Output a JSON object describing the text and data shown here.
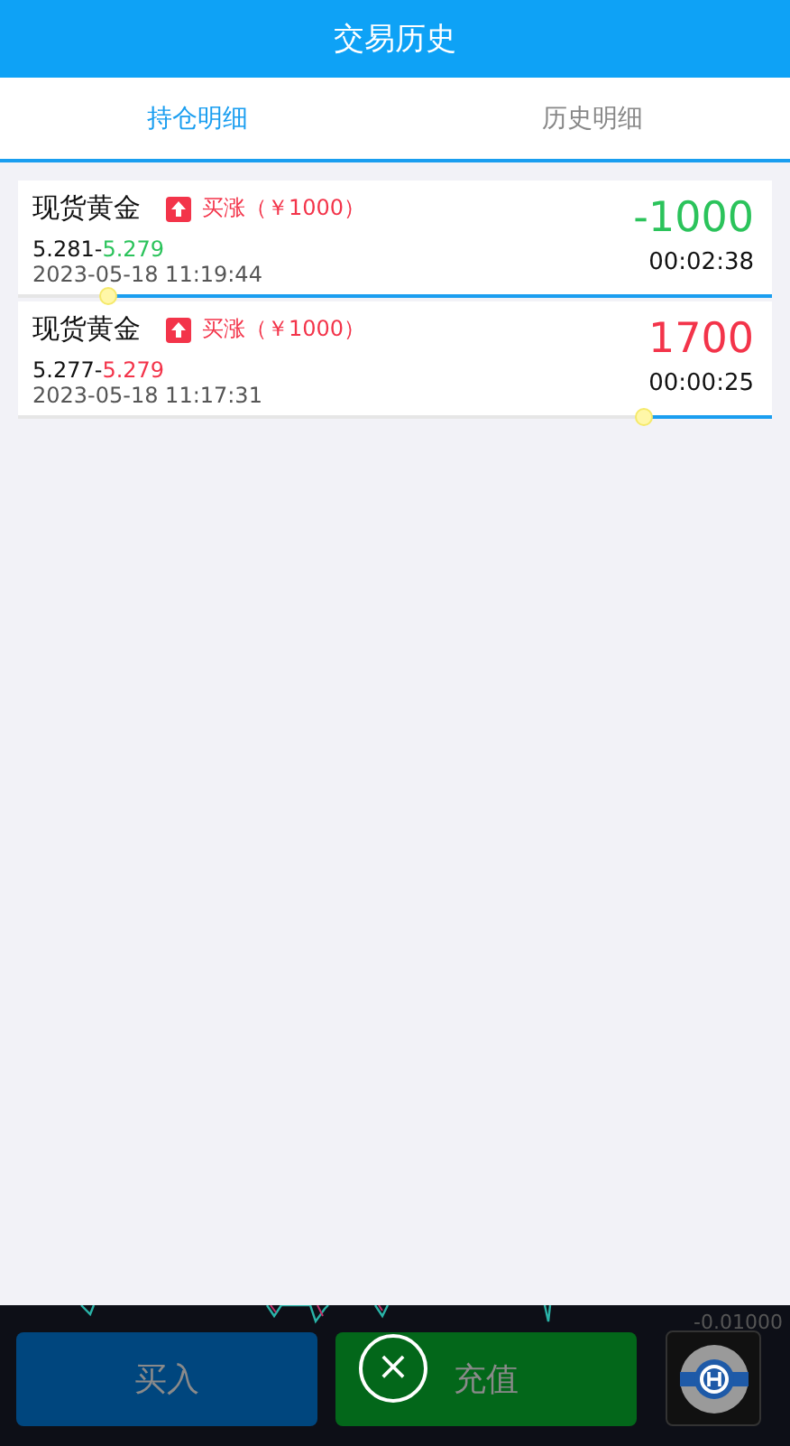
{
  "header": {
    "title": "交易历史"
  },
  "tabs": [
    {
      "label": "持仓明细",
      "selected": true
    },
    {
      "label": "历史明细",
      "selected": false
    }
  ],
  "trades": [
    {
      "name": "现货黄金",
      "rising": true,
      "tag": "买涨（￥1000）",
      "open_price": "5.281-",
      "close_price": "5.279",
      "profit": "-1000",
      "profitable": false,
      "time": "2023-05-18 11:19:44",
      "duration": "00:02:38"
    },
    {
      "name": "现货黄金",
      "rising": true,
      "tag": "买涨（￥1000）",
      "open_price": "5.277-",
      "close_price": "5.279",
      "profit": "1700",
      "profitable": true,
      "time": "2023-05-18 11:17:31",
      "duration": "00:00:25"
    }
  ],
  "bottom_bar": {
    "axis_value": "-0.01000",
    "buttons": [
      {
        "label": "买入",
        "kind": "buy"
      },
      {
        "label": "充值",
        "kind": "deposit"
      }
    ],
    "close_symbol": "×"
  }
}
